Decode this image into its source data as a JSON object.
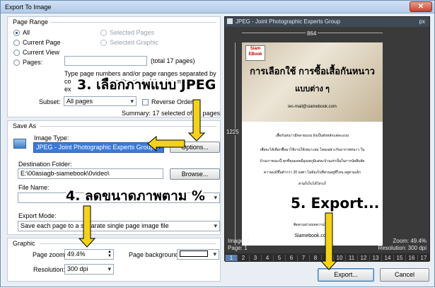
{
  "window": {
    "title": "Export To Image"
  },
  "page_range": {
    "title": "Page Range",
    "all": "All",
    "current_page": "Current Page",
    "current_view": "Current View",
    "pages": "Pages:",
    "selected_pages": "Selected Pages",
    "selected_graphic": "Selected Graphic",
    "total_pages": "(total 17 pages)",
    "hint_line1": "Type page numbers and/or page ranges separated by",
    "hint_line2": "co",
    "hint_line3": "ex",
    "hint_fragment": "from the start of the document. For",
    "subset_label": "Subset:",
    "subset_value": "All pages",
    "reverse_order": "Reverse Order",
    "summary": "Summary: 17 selected of 17 pages"
  },
  "save_as": {
    "title": "Save As",
    "image_type_label": "Image Type:",
    "image_type_value": "JPEG - Joint Photographic Experts Group",
    "options_button": "Options...",
    "destination_label": "Destination Folder:",
    "destination_value": "E:\\00asiagb-siamebook\\0video\\",
    "browse_button": "Browse...",
    "file_name_label": "File Name:",
    "export_mode_label": "Export Mode:",
    "export_mode_value": "Save each page to a separate single page image file"
  },
  "graphic": {
    "title": "Graphic",
    "zoom_label": "Page zoom:",
    "zoom_value": "49.4%",
    "resolution_label": "Resolution:",
    "resolution_value": "300 dpi",
    "background_label": "Page background:"
  },
  "preview": {
    "header": "JPEG - Joint Photographic Experts Group",
    "unit": "px",
    "width_px": "864",
    "height_px": "1225",
    "image_info": "Image: 1",
    "page_info": "Page: 1",
    "zoom_info": "Zoom: 49.4%",
    "resolution_info": "Resolution: 300 dpi",
    "page_title_line1": "การเลือกใช้ การซื้อเสื้อกันหนาว",
    "page_title_line2": "แบบต่าง ๆ",
    "page_email": "ies-mail@siamebook.com",
    "page_body_line1": "เสื้อกันหนาวมีหลายแบบ ยังเป็นตังหลักแต่ละแบบ",
    "page_body_line2": "เพื่อจะได้เลือกซื้อมาใช้งานให้เหมาะสม โดยเฉพาะกับอากาศหนาว ใน",
    "page_body_line3": "บ้านเราขณะนี้ ทุกที่คุณเคยมีอุณหภูมิแต่ละบ้านเท่านั้นในการนัยสีบสัด",
    "page_body_line4": "ความแม้ขึ้นตำกว่า 20 องศา ไม่ต้องไปที่สวนอยู่ที่ไหน อยู่สามเด็ก",
    "page_body_line5": "สามก็เก็บได้ไหวเก็",
    "page_footer_contact": "ติดตามอ่านบทความได้ที่",
    "page_footer_site": "Siamebook.com",
    "logo_text": "Siam\nEBook",
    "thumbnails": [
      "1",
      "2",
      "3",
      "4",
      "5",
      "6",
      "7",
      "8",
      "9",
      "10",
      "11",
      "12",
      "13",
      "14",
      "15",
      "16",
      "17"
    ]
  },
  "buttons": {
    "export": "Export...",
    "cancel": "Cancel"
  },
  "annotations": {
    "step3": "3. เลือกภาพแบบ JPEG",
    "step4": "4. ลดขนาดภาพตาม %",
    "step5": "5. Export..."
  },
  "colors": {
    "accent": "#1e4fa8",
    "selection": "#3b7ad8",
    "arrow": "#f3d21a"
  }
}
